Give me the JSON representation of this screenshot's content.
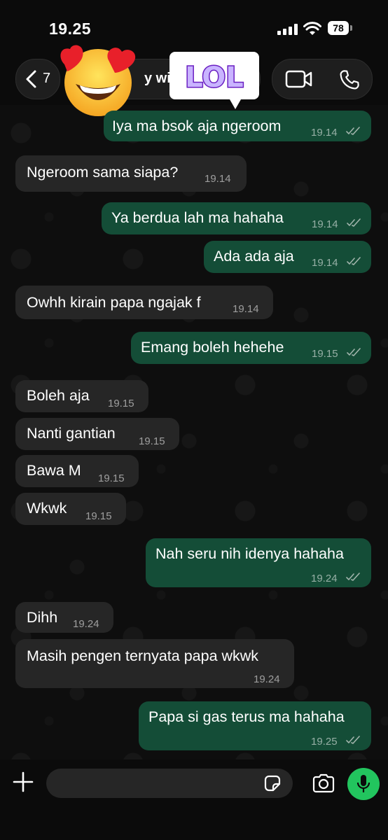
{
  "status_bar": {
    "time": "19.25",
    "battery": "78"
  },
  "header": {
    "back_count": "7",
    "contact_name": "y wife"
  },
  "stickers": {
    "lol_text": "LOL"
  },
  "messages": [
    {
      "dir": "out",
      "text": "Iya ma bsok aja ngeroom",
      "time": "19.14",
      "read": true
    },
    {
      "dir": "in",
      "text": "Ngeroom sama siapa?",
      "time": "19.14"
    },
    {
      "dir": "out",
      "text": "Ya berdua lah ma hahaha",
      "time": "19.14",
      "read": true
    },
    {
      "dir": "out",
      "text": "Ada ada aja",
      "time": "19.14",
      "read": true
    },
    {
      "dir": "in",
      "text": "Owhh kirain papa ngajak f",
      "time": "19.14"
    },
    {
      "dir": "out",
      "text": "Emang boleh hehehe",
      "time": "19.15",
      "read": true
    },
    {
      "dir": "in",
      "text": "Boleh aja",
      "time": "19.15"
    },
    {
      "dir": "in",
      "text": "Nanti gantian",
      "time": "19.15"
    },
    {
      "dir": "in",
      "text": "Bawa M",
      "time": "19.15"
    },
    {
      "dir": "in",
      "text": "Wkwk",
      "time": "19.15"
    },
    {
      "dir": "out",
      "text": "Nah seru nih idenya hahaha",
      "time": "19.24",
      "read": true
    },
    {
      "dir": "in",
      "text": "Dihh",
      "time": "19.24"
    },
    {
      "dir": "in",
      "text": "Masih pengen ternyata papa wkwk",
      "time": "19.24"
    },
    {
      "dir": "out",
      "text": "Papa si gas terus ma hahaha",
      "time": "19.25",
      "read": true
    }
  ],
  "composer": {
    "placeholder": ""
  },
  "colors": {
    "outgoing": "#144d37",
    "incoming": "#262626",
    "mic": "#22c55e",
    "read_ticks": "#9fb3aa"
  },
  "icons": [
    "chevron-left-icon",
    "video-camera-icon",
    "phone-icon",
    "plus-icon",
    "sticker-icon",
    "camera-icon",
    "microphone-icon"
  ]
}
